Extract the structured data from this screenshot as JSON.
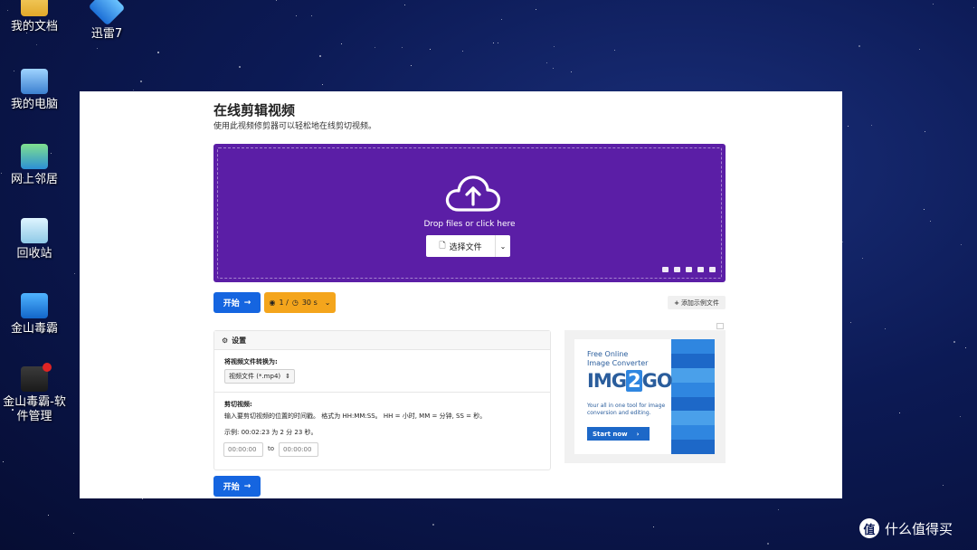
{
  "desktop": {
    "icons": [
      {
        "label": "我的文档"
      },
      {
        "label": "迅雷7"
      },
      {
        "label": "我的电脑"
      },
      {
        "label": "网上邻居"
      },
      {
        "label": "回收站"
      },
      {
        "label": "金山毒霸"
      },
      {
        "label": "金山毒霸-软件管理"
      }
    ]
  },
  "page": {
    "title": "在线剪辑视频",
    "subtitle": "使用此视频修剪器可以轻松地在线剪切视频。",
    "dropzone": {
      "prompt": "Drop files or click here",
      "choose_label": "选择文件",
      "accent": "#5b1ea6"
    },
    "actions": {
      "start_label": "开始",
      "limit_count": "1 /",
      "limit_time": "30 s",
      "add_sample_label": "添加示例文件"
    },
    "settings": {
      "header": "设置",
      "convert_label": "将视频文件转换为:",
      "format_value": "视频文件 (*.mp4)",
      "trim_label": "剪切视频:",
      "trim_hint": "输入要剪切视频的位置的时间戳。 格式为 HH:MM:SS。 HH = 小时, MM = 分钟, SS = 秒。",
      "example": "示例:  00:02:23 为 2 分 23 秒。",
      "start_placeholder": "00:00:00",
      "to_label": "to",
      "end_placeholder": "00:00:00"
    },
    "ad": {
      "line1": "Free Online",
      "line2": "Image Converter",
      "logo_a": "IMG",
      "logo_b": "2",
      "logo_c": "GO",
      "desc": "Your all in one tool for image conversion and editing.",
      "cta": "Start now"
    },
    "bottom_start_label": "开始"
  },
  "watermark": {
    "glyph": "值",
    "text": "什么值得买"
  },
  "colors": {
    "primary": "#1565e0",
    "warning": "#f4a51c",
    "dropzone": "#5b1ea6"
  }
}
